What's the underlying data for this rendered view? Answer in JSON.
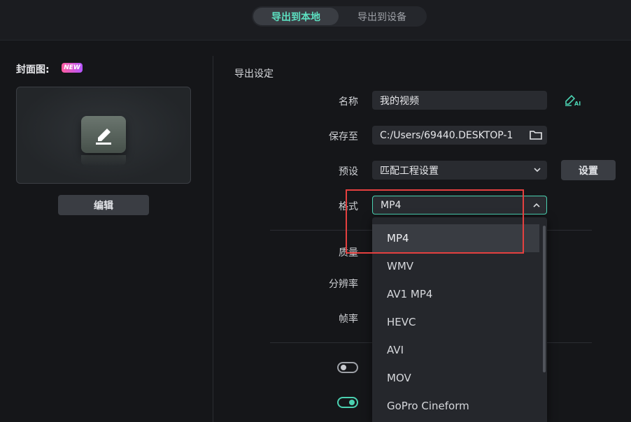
{
  "tabs": [
    {
      "label": "导出到本地",
      "active": true
    },
    {
      "label": "导出到设备",
      "active": false
    }
  ],
  "cover": {
    "label": "封面图:",
    "badge": "NEW",
    "edit_label": "编辑"
  },
  "export_settings": {
    "title": "导出设定",
    "name_label": "名称",
    "name_value": "我的视频",
    "save_label": "保存至",
    "save_value": "C:/Users/69440.DESKTOP-1",
    "preset_label": "预设",
    "preset_value": "匹配工程设置",
    "settings_button": "设置",
    "format_label": "格式",
    "format_value": "MP4",
    "quality_label": "质量",
    "resolution_label": "分辨率",
    "framerate_label": "帧率"
  },
  "format_dropdown": {
    "options": [
      "MP4",
      "WMV",
      "AV1 MP4",
      "HEVC",
      "AVI",
      "MOV",
      "GoPro Cineform"
    ],
    "selected": "MP4"
  },
  "toggles": [
    {
      "state": "off"
    },
    {
      "state": "on"
    }
  ],
  "colors": {
    "accent": "#4bd1b1",
    "highlight": "#e5403f",
    "background": "#151619"
  }
}
